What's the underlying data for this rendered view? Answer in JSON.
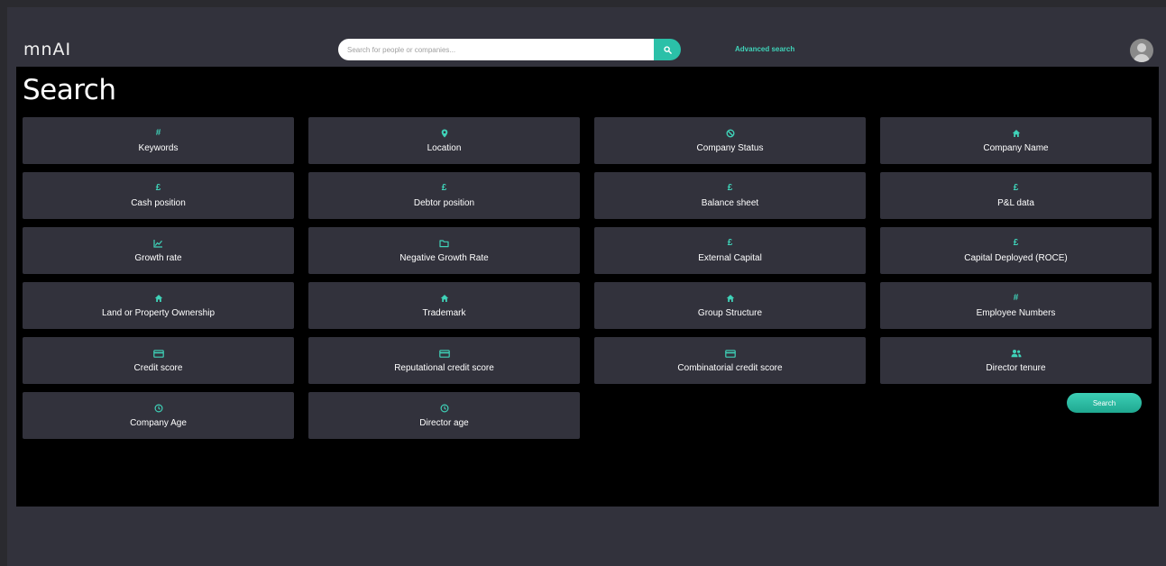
{
  "header": {
    "logo": "mnAI",
    "search_placeholder": "Search for people or companies...",
    "search_icon": "search-icon",
    "advanced_search": "Advanced search",
    "avatar_icon": "user-avatar-icon"
  },
  "page": {
    "title": "Search"
  },
  "filters": [
    {
      "label": "Keywords",
      "icon": "hash-icon"
    },
    {
      "label": "Location",
      "icon": "location-pin-icon"
    },
    {
      "label": "Company Status",
      "icon": "block-icon"
    },
    {
      "label": "Company Name",
      "icon": "home-icon"
    },
    {
      "label": "Cash position",
      "icon": "pound-icon"
    },
    {
      "label": "Debtor position",
      "icon": "pound-icon"
    },
    {
      "label": "Balance sheet",
      "icon": "pound-icon"
    },
    {
      "label": "P&L data",
      "icon": "pound-icon"
    },
    {
      "label": "Growth rate",
      "icon": "line-chart-icon"
    },
    {
      "label": "Negative Growth Rate",
      "icon": "folder-icon"
    },
    {
      "label": "External Capital",
      "icon": "pound-icon"
    },
    {
      "label": "Capital Deployed (ROCE)",
      "icon": "pound-icon"
    },
    {
      "label": "Land or Property Ownership",
      "icon": "home-icon"
    },
    {
      "label": "Trademark",
      "icon": "home-icon"
    },
    {
      "label": "Group Structure",
      "icon": "home-icon"
    },
    {
      "label": "Employee Numbers",
      "icon": "hash-icon"
    },
    {
      "label": "Credit score",
      "icon": "credit-card-icon"
    },
    {
      "label": "Reputational credit score",
      "icon": "credit-card-icon"
    },
    {
      "label": "Combinatorial credit score",
      "icon": "credit-card-icon"
    },
    {
      "label": "Director tenure",
      "icon": "people-icon"
    },
    {
      "label": "Company Age",
      "icon": "clock-icon"
    },
    {
      "label": "Director age",
      "icon": "clock-icon"
    }
  ],
  "actions": {
    "search_button": "Search"
  },
  "colors": {
    "accent": "#3fd2b8",
    "tile_bg": "#32323c",
    "panel_bg": "#000000",
    "frame_bg": "#32323c"
  }
}
